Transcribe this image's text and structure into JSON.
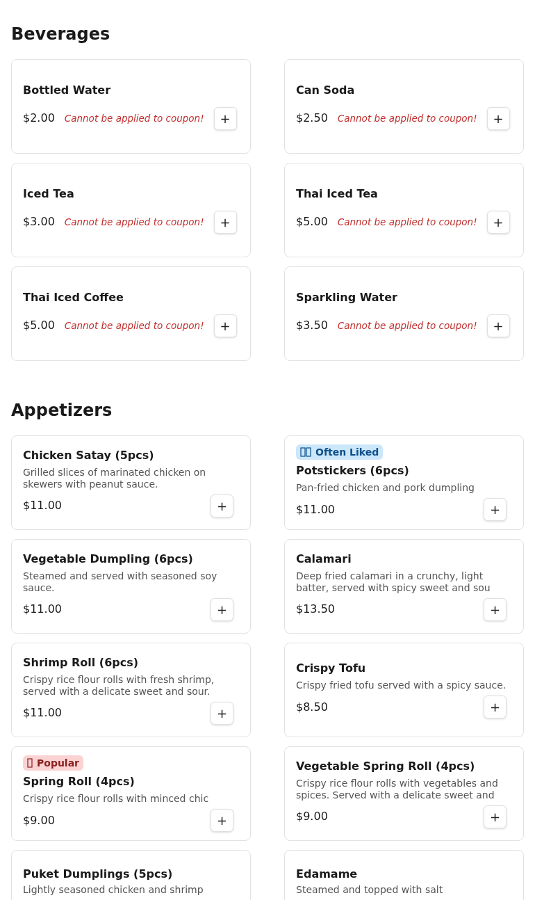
{
  "sections": [
    {
      "title": "Beverages",
      "items": [
        {
          "name": "Bottled Water",
          "price": "$2.00",
          "note": "Cannot be applied to coupon!",
          "add_label": "+"
        },
        {
          "name": "Can Soda",
          "price": "$2.50",
          "note": "Cannot be applied to coupon!",
          "add_label": "+"
        },
        {
          "name": "Iced Tea",
          "price": "$3.00",
          "note": "Cannot be applied to coupon!",
          "add_label": "+"
        },
        {
          "name": "Thai Iced Tea",
          "price": "$5.00",
          "note": "Cannot be applied to coupon!",
          "add_label": "+"
        },
        {
          "name": "Thai Iced Coffee",
          "price": "$5.00",
          "note": "Cannot be applied to coupon!",
          "add_label": "+"
        },
        {
          "name": "Sparkling Water",
          "price": "$3.50",
          "note": "Cannot be applied to coupon!",
          "add_label": "+"
        }
      ]
    },
    {
      "title": "Appetizers",
      "items": [
        {
          "name": "Chicken Satay (5pcs)",
          "description": "Grilled slices of marinated chicken on skewers with peanut sauce.",
          "price": "$11.00",
          "add_label": "+"
        },
        {
          "badge": {
            "kind": "often_liked",
            "label": "Often Liked"
          },
          "name": "Potstickers (6pcs)",
          "description": "Pan-fried chicken and pork dumpling",
          "price": "$11.00",
          "add_label": "+"
        },
        {
          "name": "Vegetable Dumpling (6pcs)",
          "description": "Steamed and served with seasoned soy sauce.",
          "price": "$11.00",
          "add_label": "+"
        },
        {
          "name": "Calamari",
          "description": "Deep fried calamari in a crunchy, light batter, served with spicy sweet and sou",
          "price": "$13.50",
          "add_label": "+"
        },
        {
          "name": "Shrimp Roll (6pcs)",
          "description": "Crispy rice flour rolls with fresh shrimp, served with a delicate sweet and sour.",
          "price": "$11.00",
          "add_label": "+"
        },
        {
          "name": "Crispy Tofu",
          "description": "Crispy fried tofu served with a spicy sauce.",
          "price": "$8.50",
          "add_label": "+"
        },
        {
          "badge": {
            "kind": "popular",
            "label": "Popular"
          },
          "name": "Spring Roll (4pcs)",
          "description": "Crispy rice flour rolls with minced chic",
          "price": "$9.00",
          "add_label": "+"
        },
        {
          "name": "Vegetable Spring Roll (4pcs)",
          "description": "Crispy rice flour rolls with vegetables and spices. Served with a delicate sweet and",
          "price": "$9.00",
          "add_label": "+"
        },
        {
          "name": "Puket Dumplings (5pcs)",
          "description": "Lightly seasoned chicken and shrimp"
        },
        {
          "name": "Edamame",
          "description": "Steamed and topped with salt"
        }
      ]
    }
  ]
}
